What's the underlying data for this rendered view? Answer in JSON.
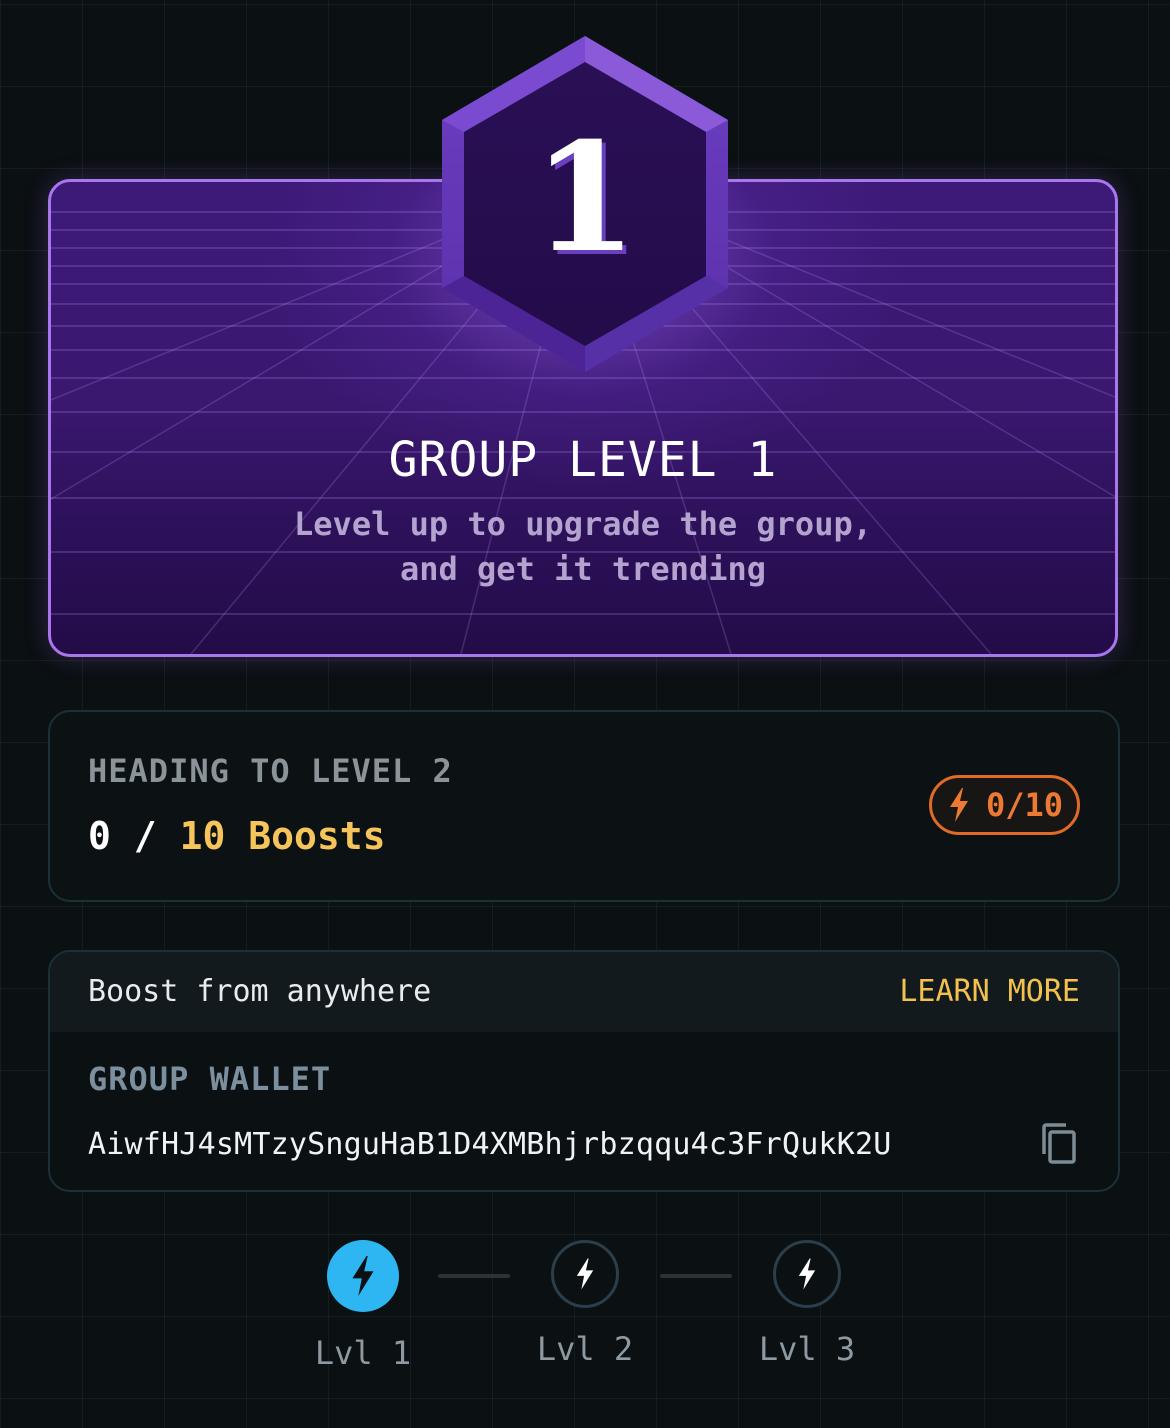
{
  "hero": {
    "badge_level": "1",
    "title": "GROUP LEVEL 1",
    "subtitle_line1": "Level up to upgrade the group,",
    "subtitle_line2": "and get it trending"
  },
  "progress": {
    "heading": "HEADING TO LEVEL 2",
    "current": "0",
    "separator": "/",
    "target": "10 Boosts",
    "pill_text": "0/10",
    "pill_icon": "bolt-icon",
    "fraction": 0
  },
  "wallet": {
    "top_label": "Boost from anywhere",
    "learn_more": "LEARN MORE",
    "heading": "GROUP WALLET",
    "address": "AiwfHJ4sMTzySnguHaB1D4XMBhjrbzqqu4c3FrQukK2U",
    "copy_icon": "copy-icon"
  },
  "levels": [
    {
      "label": "Lvl 1",
      "active": true
    },
    {
      "label": "Lvl 2",
      "active": false
    },
    {
      "label": "Lvl 3",
      "active": false
    }
  ],
  "colors": {
    "accent_purple": "#a877ee",
    "accent_gold": "#f5c45a",
    "accent_orange": "#e06a28",
    "accent_blue": "#2eb6f2"
  }
}
